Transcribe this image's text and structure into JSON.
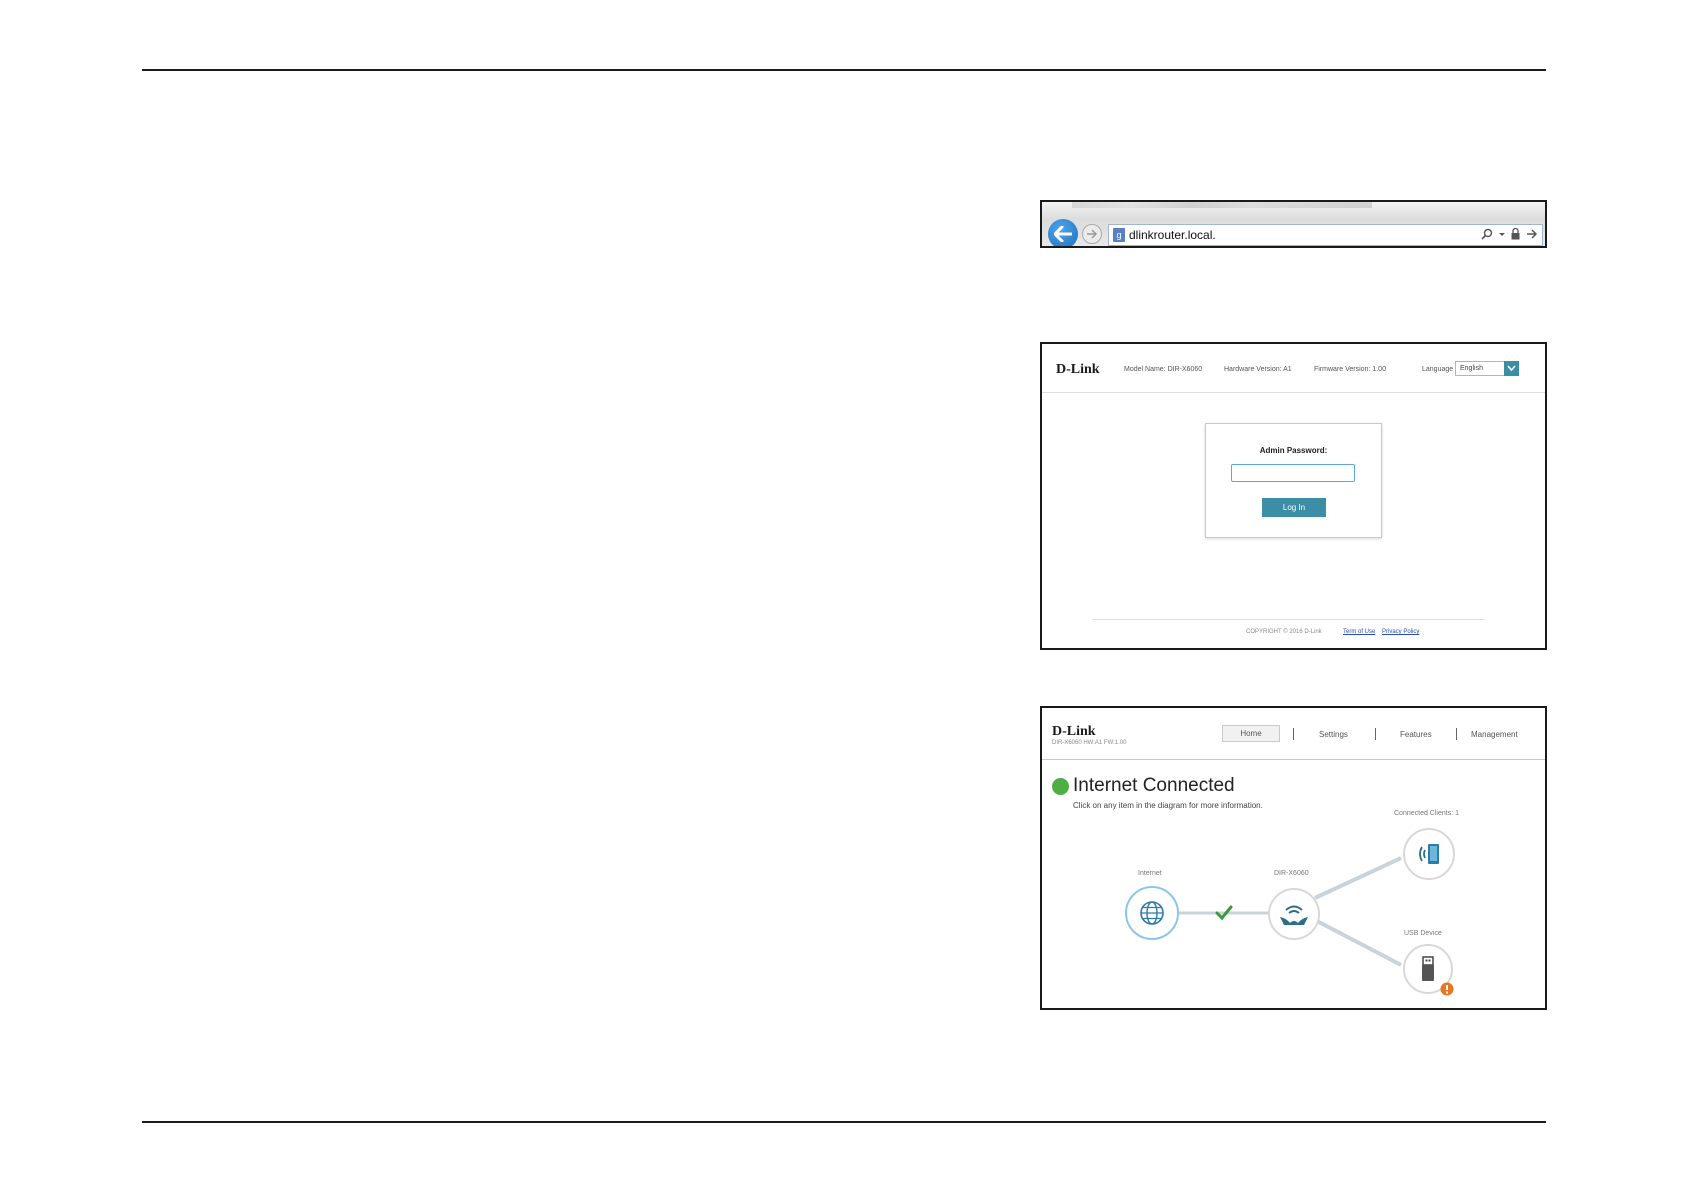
{
  "browser": {
    "url": "dlinkrouter.local.",
    "page_icon": "page-icon",
    "back_icon": "back-arrow-icon",
    "forward_icon": "forward-arrow-icon",
    "toolbar_icons": [
      "search-icon",
      "dropdown-icon",
      "lock-icon",
      "go-arrow-icon"
    ]
  },
  "login_page": {
    "logo": "D-Link",
    "model_name": "Model Name: DIR-X6060",
    "hardware_version": "Hardware Version: A1",
    "firmware_version": "Firmware Version: 1.00",
    "language_label": "Language",
    "language_value": "English",
    "admin_password_label": "Admin Password:",
    "login_button": "Log In",
    "copyright": "COPYRIGHT © 2016 D-Link",
    "terms_link": "Term of Use",
    "privacy_link": "Privacy Policy",
    "accent_color": "#3b8ea5"
  },
  "home_page": {
    "logo": "D-Link",
    "model_line": "DIR-X6060 HW:A1 FW:1.00",
    "nav": [
      "Home",
      "Settings",
      "Features",
      "Management"
    ],
    "status_title": "Internet Connected",
    "status_subtitle": "Click on any item in the diagram for more information.",
    "status_color": "#4cae43",
    "labels": {
      "internet": "Internet",
      "router": "DIR-X6060",
      "clients": "Connected Clients: 1",
      "usb": "USB Device"
    },
    "icons": [
      "globe-icon",
      "router-icon",
      "wireless-client-icon",
      "usb-icon",
      "checkmark-icon",
      "warning-icon"
    ],
    "warning_color": "#e87722"
  }
}
